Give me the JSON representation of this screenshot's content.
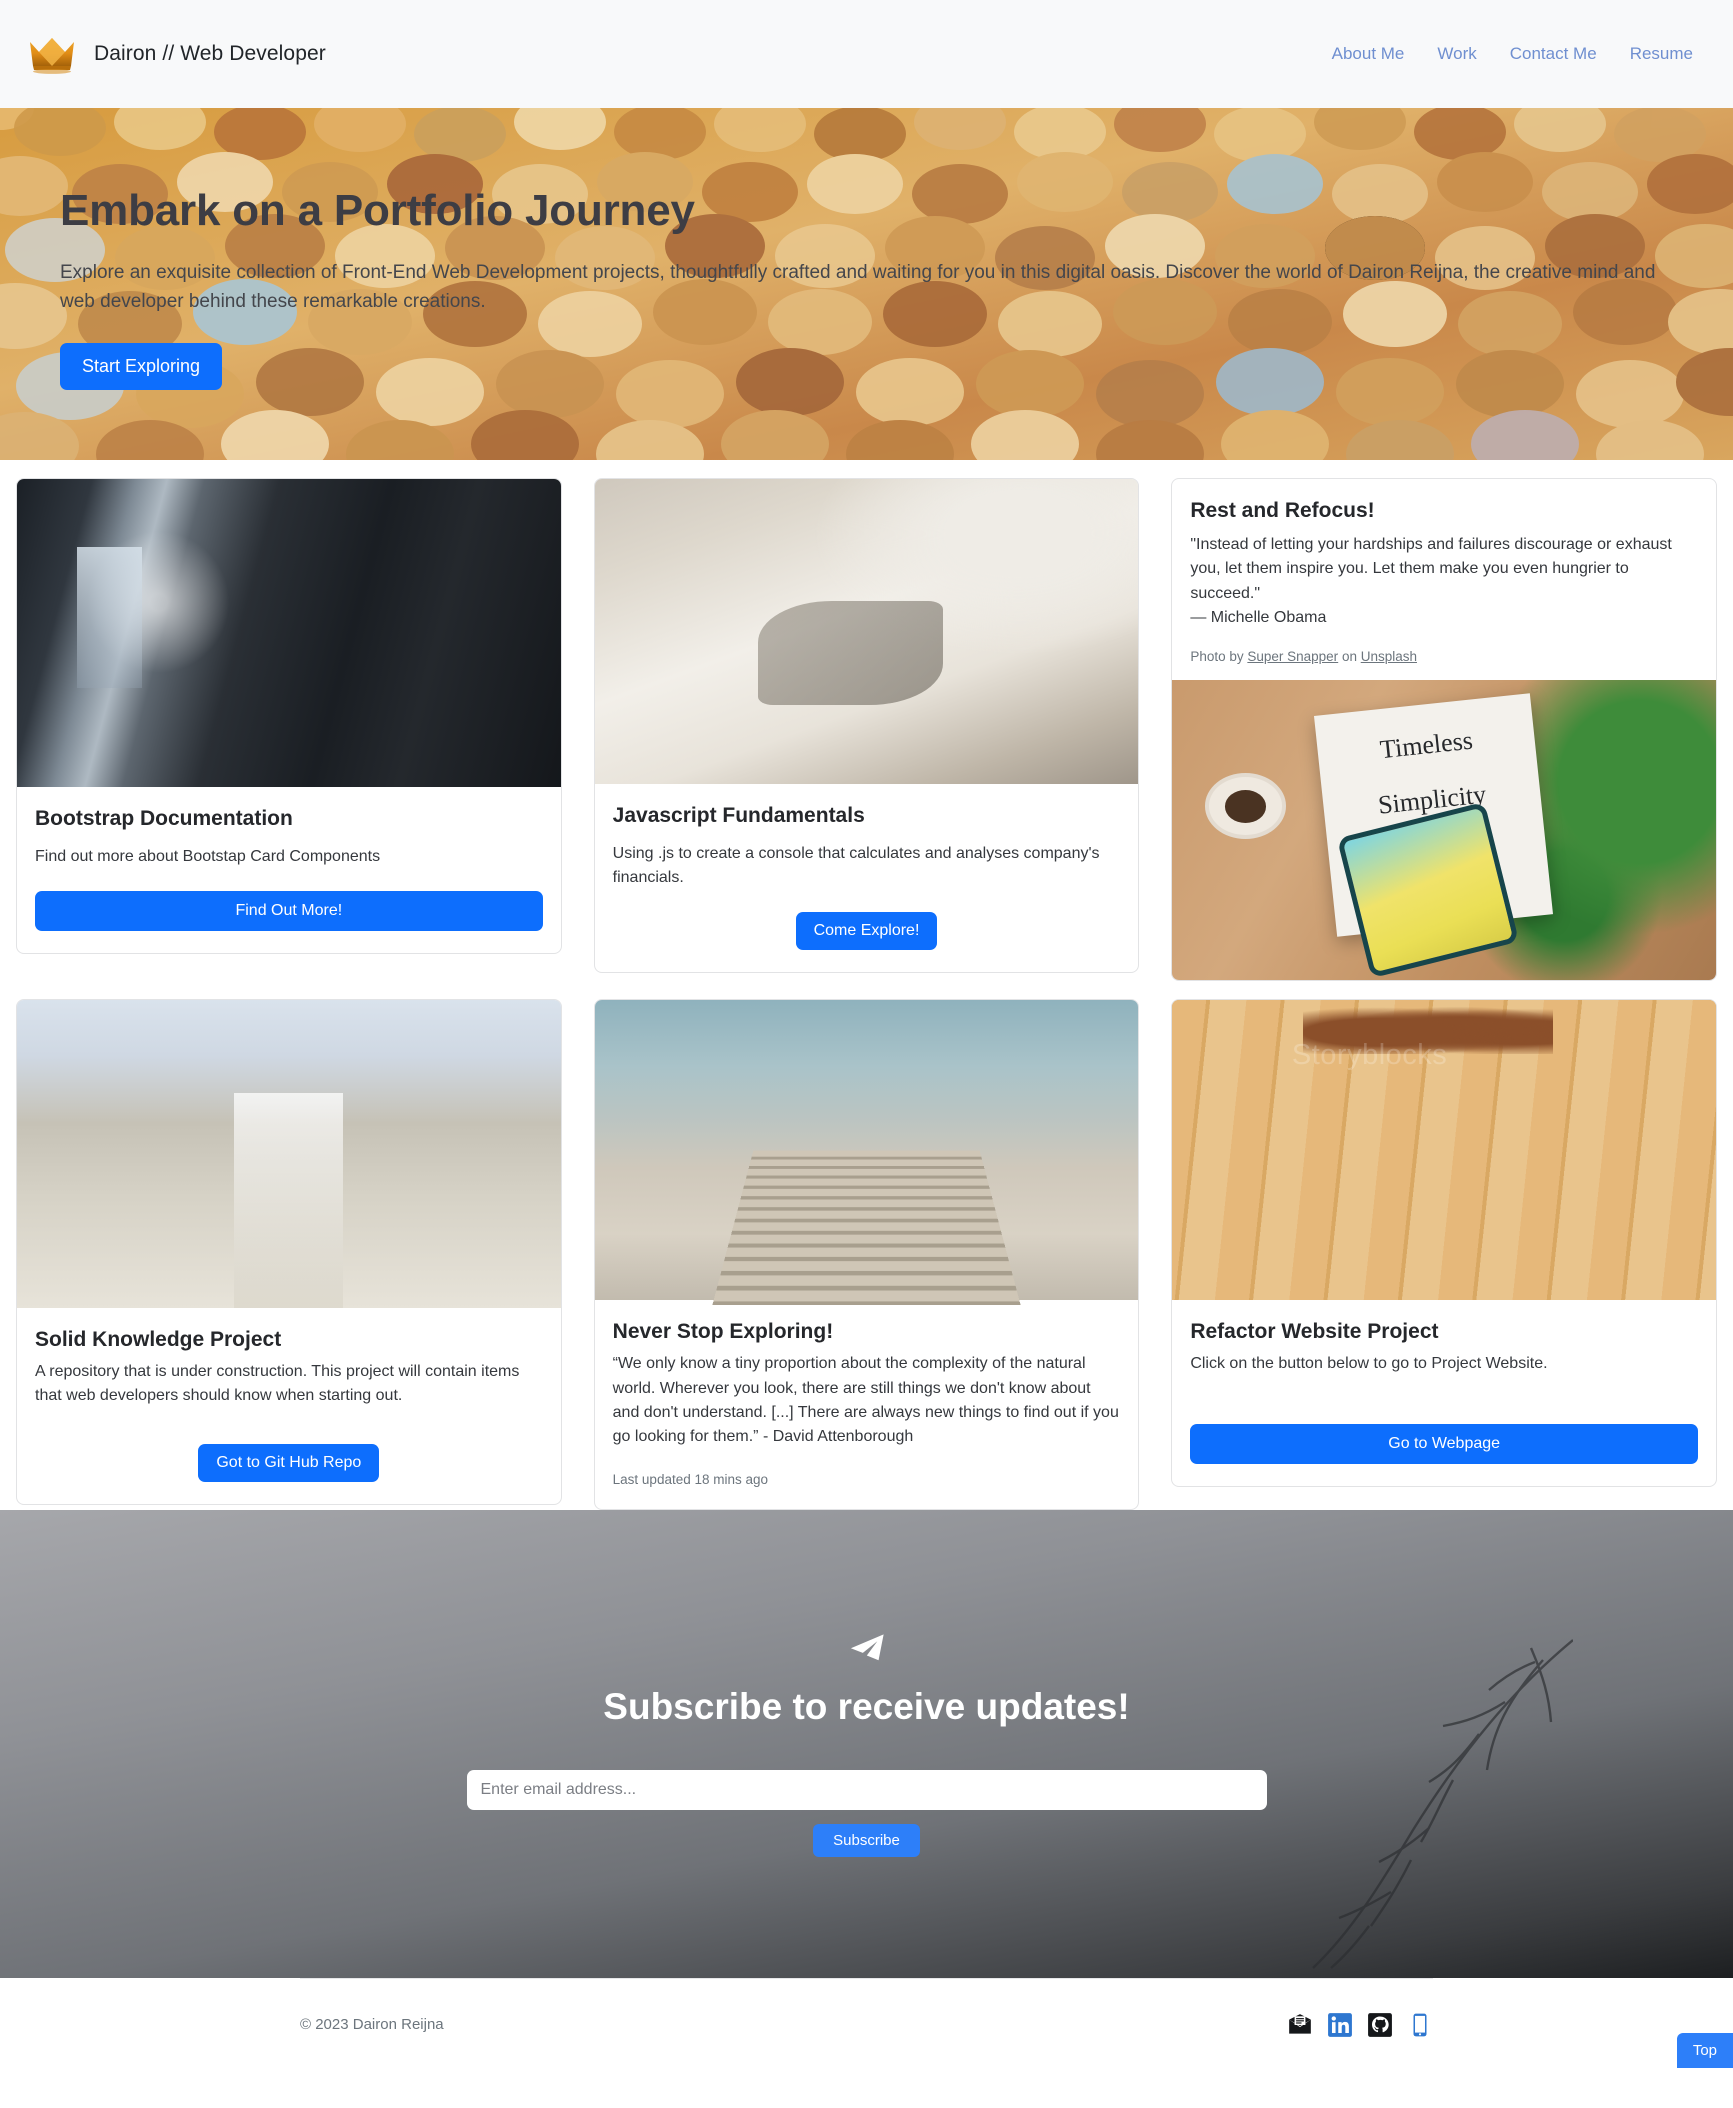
{
  "navbar": {
    "brand": "Dairon // Web Developer",
    "logo_icon": "crown-icon",
    "links": [
      {
        "label": "About Me"
      },
      {
        "label": "Work"
      },
      {
        "label": "Contact Me"
      },
      {
        "label": "Resume"
      }
    ]
  },
  "hero": {
    "title": "Embark on a Portfolio Journey",
    "subtitle": "Explore an exquisite collection of Front-End Web Development projects, thoughtfully crafted and waiting for you in this digital oasis. Discover the world of Dairon Reijna, the creative mind and web developer behind these remarkable creations.",
    "cta_label": "Start Exploring"
  },
  "cards": {
    "bootstrap": {
      "title": "Bootstrap Documentation",
      "text": "Find out more about Bootstap Card Components",
      "button": "Find Out More!",
      "image_alt": "dark-room-with-chairs-photo"
    },
    "javascript": {
      "title": "Javascript Fundamentals",
      "text": "Using .js to create a console that calculates and analyses company's financials.",
      "button": "Come Explore!",
      "image_alt": "hand-writing-on-paper-photo"
    },
    "rest": {
      "title": "Rest and Refocus!",
      "quote": "\"Instead of letting your hardships and failures discourage or exhaust you, let them inspire you. Let them make you even hungrier to succeed.\"",
      "attribution": "— Michelle Obama",
      "photo_credit_prefix": "Photo by ",
      "photo_credit_author": "Super Snapper",
      "photo_credit_middle": " on ",
      "photo_credit_source": "Unsplash",
      "image_book_line1": "Timeless",
      "image_book_line2": "Simplicity",
      "image_alt": "book-phone-coffee-on-desk-photo"
    },
    "solid": {
      "title": "Solid Knowledge Project",
      "text": "A repository that is under construction. This project will contain items that web developers should know when starting out.",
      "button": "Got to Git Hub Repo",
      "image_alt": "ornate-library-interior-photo"
    },
    "never": {
      "title": "Never Stop Exploring!",
      "quote": "“We only know a tiny proportion about the complexity of the natural world. Wherever you look, there are still things we don't know about and don't understand. [...] There are always new things to find out if you go looking for them.” - David Attenborough",
      "footnote": "Last updated 18 mins ago",
      "image_alt": "dog-on-pier-photo"
    },
    "refactor": {
      "title": "Refactor Website Project",
      "text": "Click on the button below to go to Project Website.",
      "button": "Go to Webpage",
      "watermark": "Storyblocks",
      "image_alt": "wooden-floor-photo"
    }
  },
  "subscribe": {
    "icon": "paper-plane-icon",
    "title": "Subscribe to receive updates!",
    "email_placeholder": "Enter email address...",
    "email_value": "",
    "button": "Subscribe"
  },
  "footer": {
    "copyright": "© 2023 Dairon Reijna",
    "socials": [
      {
        "name": "email-icon"
      },
      {
        "name": "linkedin-icon"
      },
      {
        "name": "github-icon"
      },
      {
        "name": "mobile-phone-icon"
      }
    ],
    "top_button": "Top"
  },
  "colors": {
    "primary": "#0d6efd",
    "accent_blue": "#2d7ff9",
    "nav_link": "#6f8fd0",
    "brand_gold": "#e49b20",
    "navbar_bg": "#f8f9fa",
    "muted": "#6c757d"
  }
}
